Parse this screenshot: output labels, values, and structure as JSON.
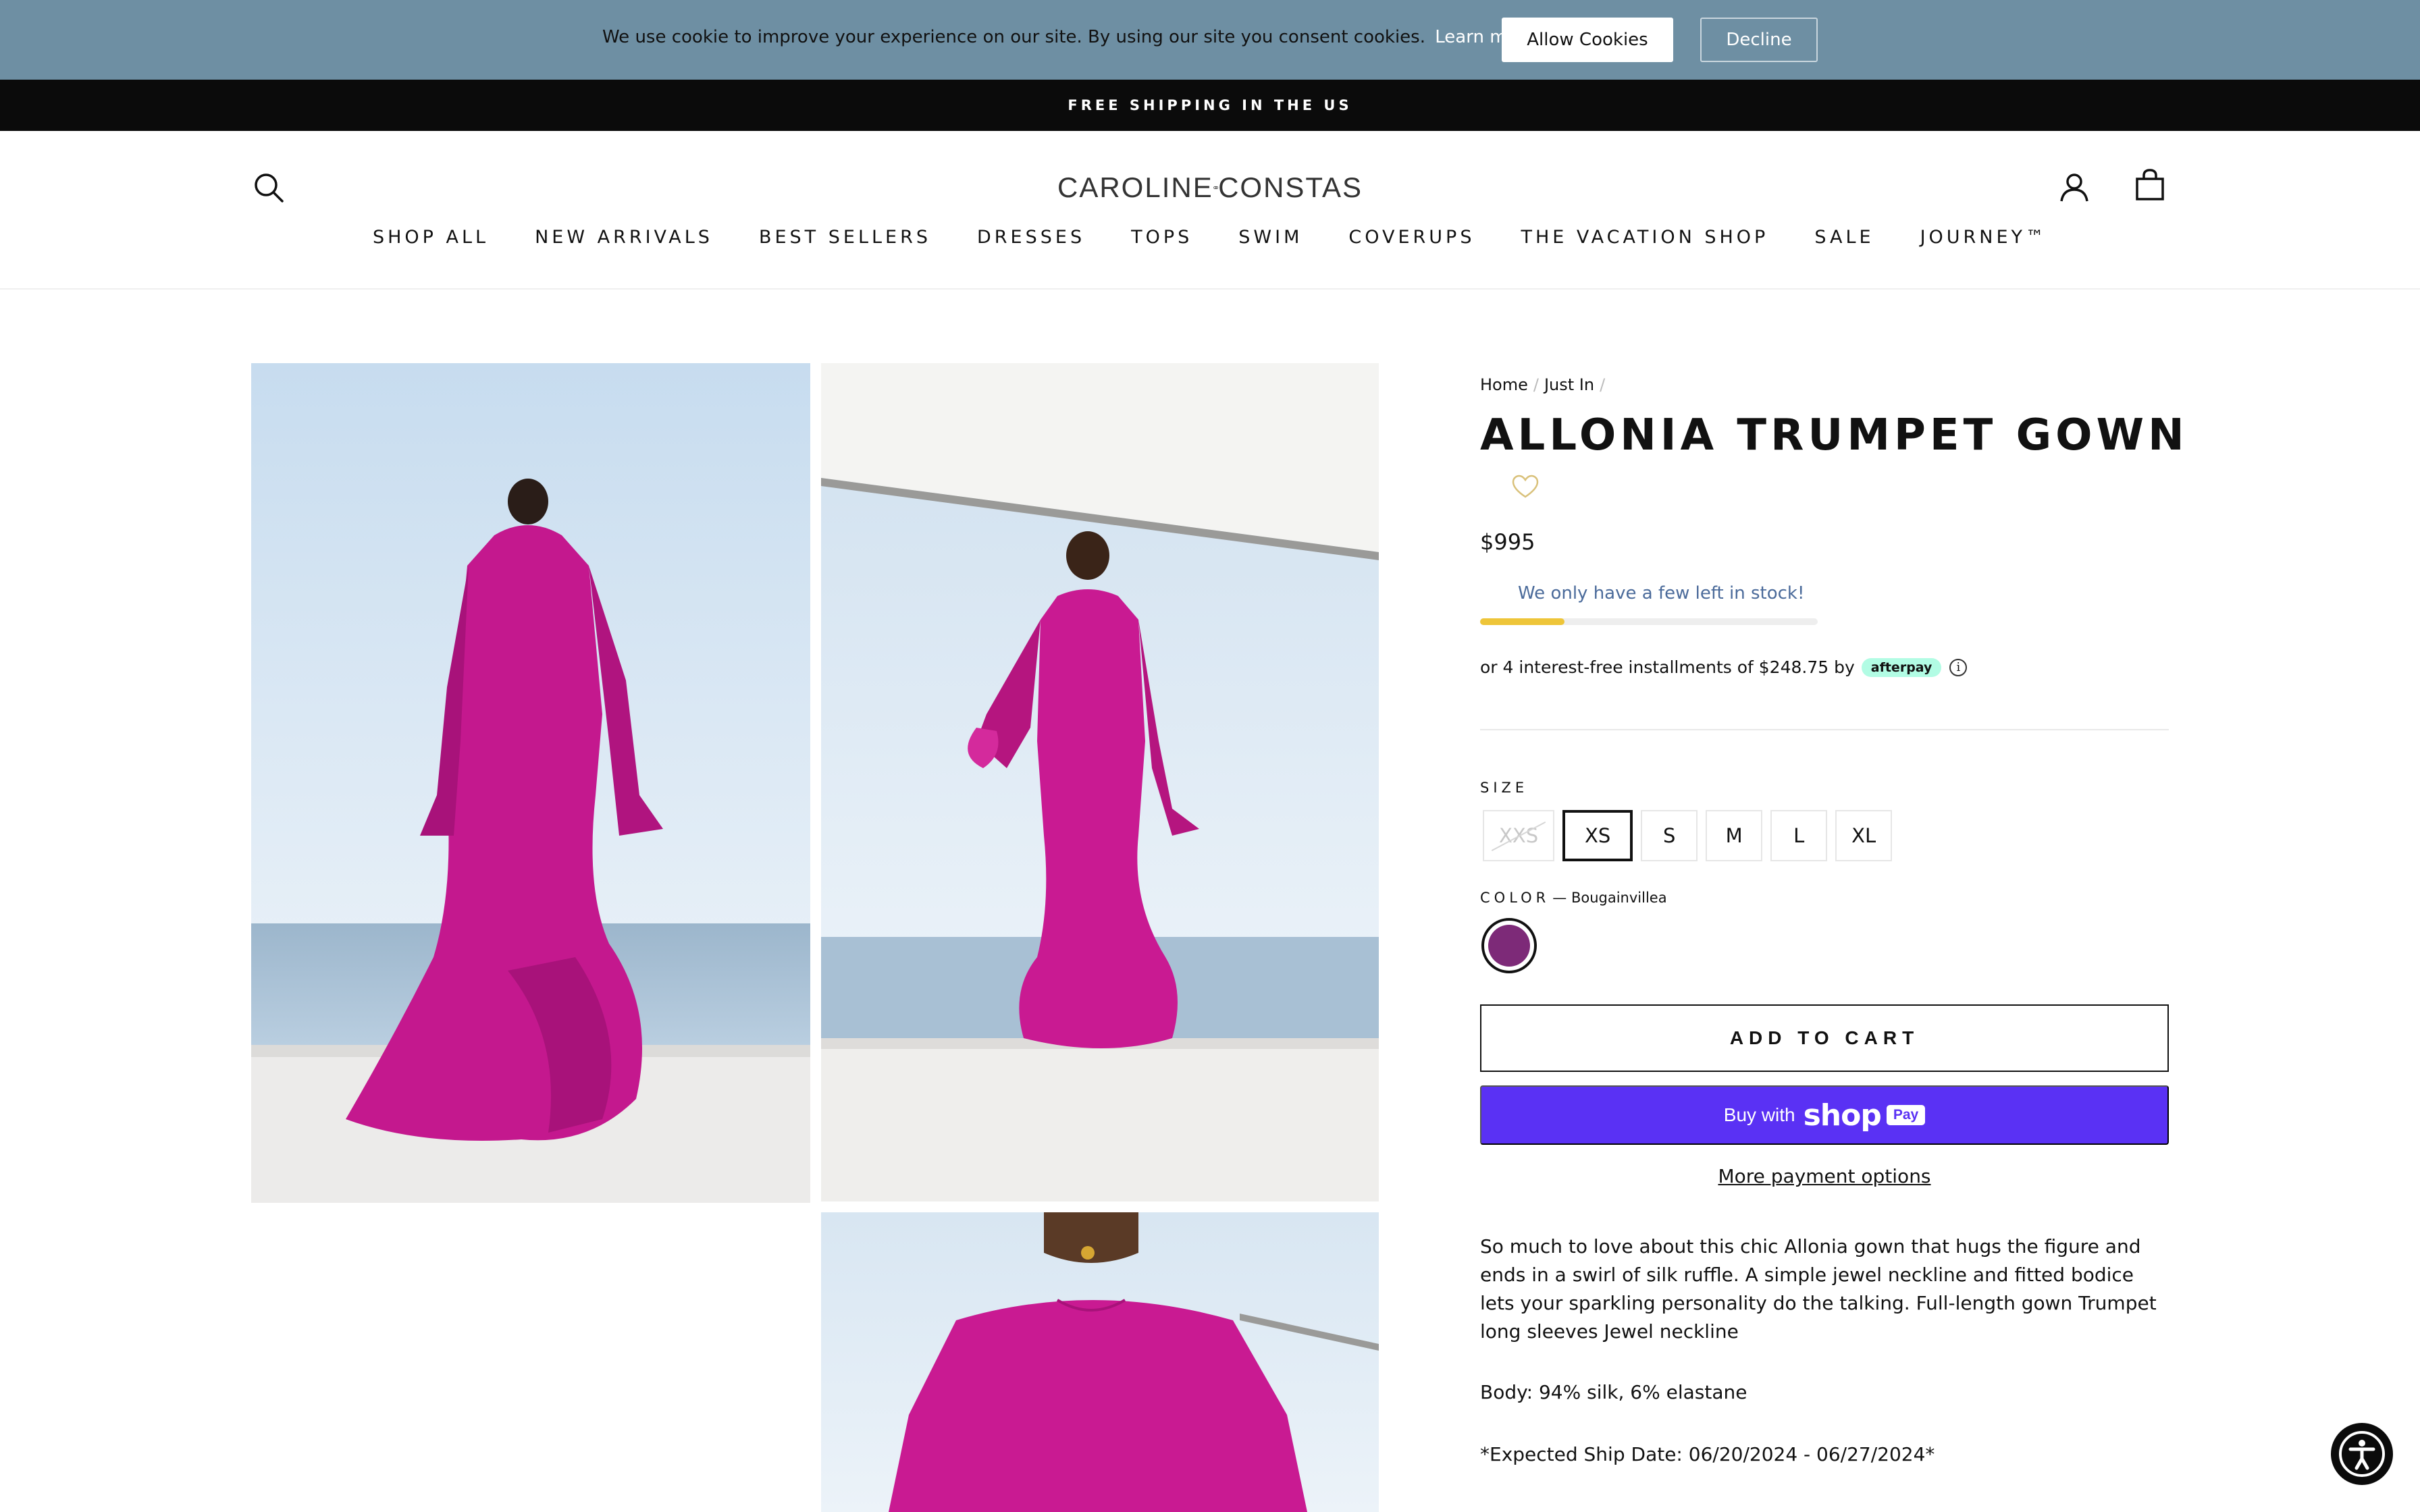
{
  "cookie_banner": {
    "message": "We use cookie to improve your experience on our site. By using our site you consent cookies.",
    "learn_more": "Learn more",
    "allow_label": "Allow Cookies",
    "decline_label": "Decline"
  },
  "announcement": "FREE SHIPPING IN THE US",
  "header": {
    "logo_left": "CAROLINE",
    "logo_right": "CONSTAS",
    "icons": [
      "search-icon",
      "account-icon",
      "cart-icon"
    ],
    "nav": [
      "SHOP ALL",
      "NEW ARRIVALS",
      "BEST SELLERS",
      "DRESSES",
      "TOPS",
      "SWIM",
      "COVERUPS",
      "THE VACATION SHOP",
      "SALE",
      "JOURNEY™"
    ]
  },
  "product": {
    "breadcrumb": [
      "Home",
      "Just In"
    ],
    "title": "ALLONIA TRUMPET GOWN",
    "price": "$995",
    "stock_message": "We only have a few left in stock!",
    "stock_level": 0.25,
    "afterpay": {
      "text": "or 4 interest-free installments of $248.75 by",
      "badge": "afterpay",
      "info": "i"
    },
    "size_label": "SIZE",
    "sizes": [
      {
        "label": "XXS",
        "available": false,
        "selected": false
      },
      {
        "label": "XS",
        "available": true,
        "selected": true
      },
      {
        "label": "S",
        "available": true,
        "selected": false
      },
      {
        "label": "M",
        "available": true,
        "selected": false
      },
      {
        "label": "L",
        "available": true,
        "selected": false
      },
      {
        "label": "XL",
        "available": true,
        "selected": false
      }
    ],
    "color_label": "COLOR",
    "color_value": "— Bougainvillea",
    "swatch_color": "#7d2a78",
    "add_to_cart": "ADD TO CART",
    "shop_pay": {
      "prefix": "Buy with",
      "brand": "shop",
      "pay": "Pay"
    },
    "more_payment": "More payment options",
    "description": "So much to love about this chic Allonia gown that hugs the figure and ends in a swirl of silk ruffle. A simple jewel neckline and fitted bodice lets your sparkling personality do the talking. Full-length gown Trumpet long sleeves Jewel neckline",
    "material": "Body: 94% silk, 6% elastane",
    "ship_date": "*Expected Ship Date: 06/20/2024 - 06/27/2024*"
  },
  "colors": {
    "cookie_bg": "#6e8fa3",
    "announce_bg": "#0b0b0b",
    "shop_pay": "#5a31f4",
    "stock_fill": "#eec539",
    "dress": "#c4188e"
  }
}
